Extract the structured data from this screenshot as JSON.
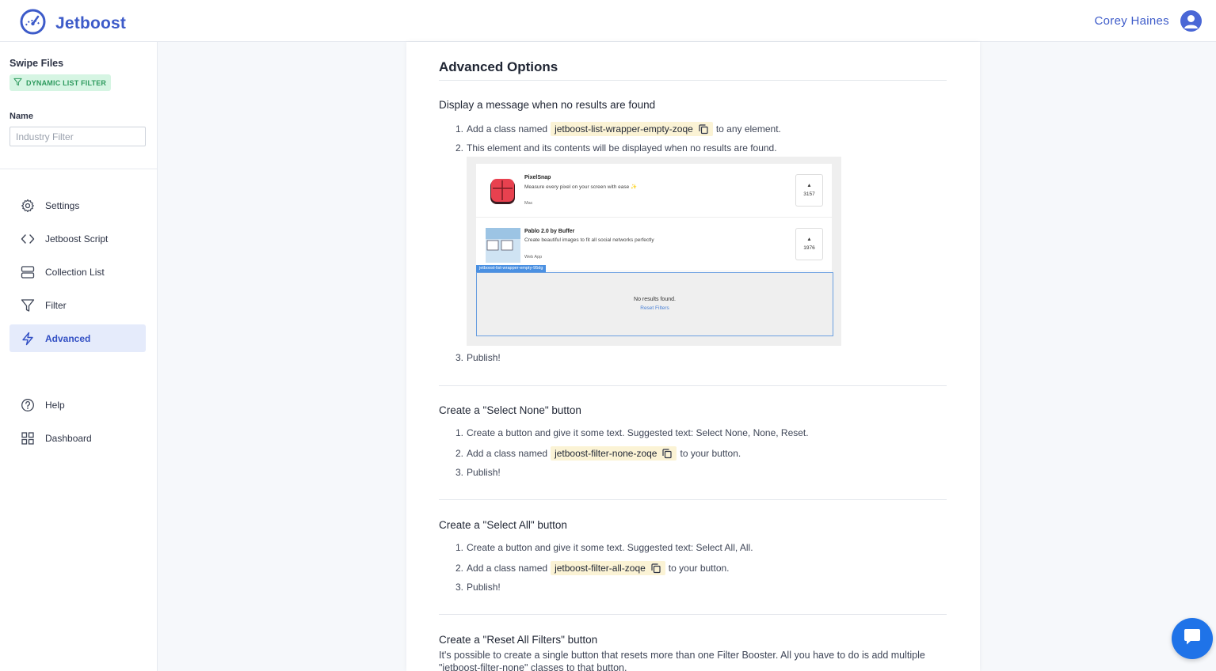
{
  "header": {
    "brand": "Jetboost",
    "user_name": "Corey Haines"
  },
  "sidebar": {
    "project_title": "Swipe Files",
    "badge": "DYNAMIC LIST FILTER",
    "name_label": "Name",
    "name_placeholder": "Industry Filter",
    "nav": [
      {
        "label": "Settings",
        "icon": "gear-icon"
      },
      {
        "label": "Jetboost Script",
        "icon": "code-icon"
      },
      {
        "label": "Collection List",
        "icon": "collection-icon"
      },
      {
        "label": "Filter",
        "icon": "filter-icon"
      },
      {
        "label": "Advanced",
        "icon": "lightning-icon",
        "active": true
      }
    ],
    "nav_bottom": [
      {
        "label": "Help",
        "icon": "help-icon"
      },
      {
        "label": "Dashboard",
        "icon": "dashboard-icon"
      }
    ]
  },
  "main": {
    "title": "Advanced Options",
    "sections": [
      {
        "title": "Display a message when no results are found",
        "steps": [
          {
            "num": "1.",
            "pre": "Add a class named",
            "code": "jetboost-list-wrapper-empty-zoqe",
            "post": "to any element."
          },
          {
            "num": "2.",
            "text": "This element and its contents will be displayed when no results are found."
          },
          {
            "num": "3.",
            "text": "Publish!"
          }
        ]
      },
      {
        "title": "Create a \"Select None\" button",
        "steps": [
          {
            "num": "1.",
            "text": "Create a button and give it some text. Suggested text: Select None, None, Reset."
          },
          {
            "num": "2.",
            "pre": "Add a class named",
            "code": "jetboost-filter-none-zoqe",
            "post": "to your button."
          },
          {
            "num": "3.",
            "text": "Publish!"
          }
        ]
      },
      {
        "title": "Create a \"Select All\" button",
        "steps": [
          {
            "num": "1.",
            "text": "Create a button and give it some text. Suggested text: Select All, All."
          },
          {
            "num": "2.",
            "pre": "Add a class named",
            "code": "jetboost-filter-all-zoqe",
            "post": "to your button."
          },
          {
            "num": "3.",
            "text": "Publish!"
          }
        ]
      },
      {
        "title": "Create a \"Reset All Filters\" button",
        "paragraph": "It's possible to create a single button that resets more than one Filter Booster. All you have to do is add multiple \"jetboost-filter-none\" classes to that button."
      }
    ],
    "example": {
      "items": [
        {
          "name": "PixelSnap",
          "desc": "Measure every pixel on your screen with ease ✨",
          "platform": "Mac",
          "votes": "3157"
        },
        {
          "name": "Pablo 2.0 by Buffer",
          "desc": "Create beautiful images to fit all social networks perfectly",
          "platform": "Web App",
          "votes": "1976"
        }
      ],
      "tag": "jetboost-list-wrapper-empty-95dg",
      "no_results": "No results found.",
      "reset": "Reset Filters"
    }
  },
  "colors": {
    "brand": "#3d5bc9",
    "active_bg": "#e5ebfb",
    "badge_bg": "#d6f5e3",
    "badge_text": "#2e9a5e",
    "code_bg": "#fbf3d5",
    "chat": "#1f73e8"
  }
}
